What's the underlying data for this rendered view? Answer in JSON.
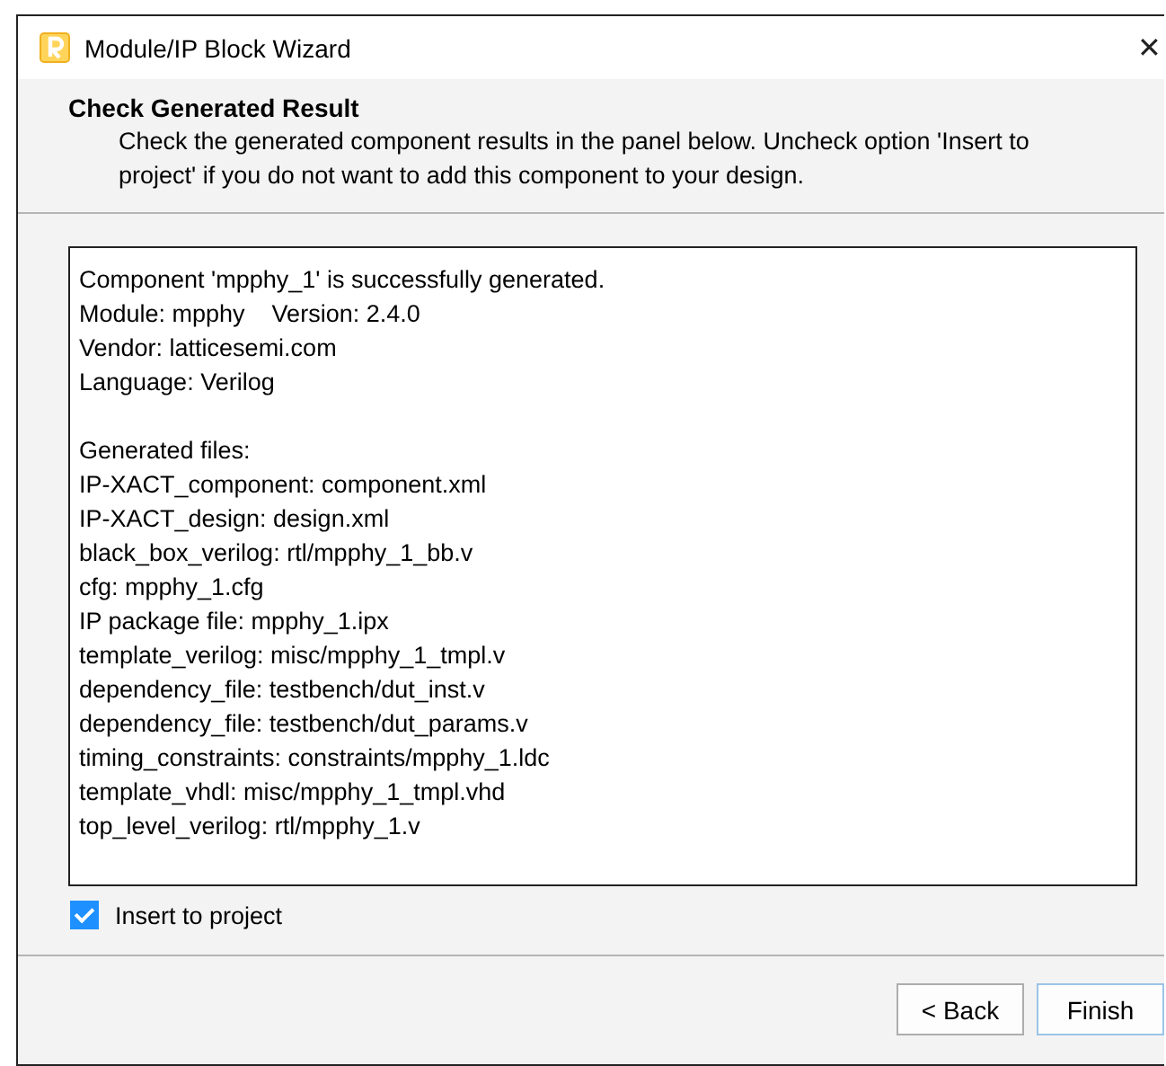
{
  "window": {
    "title": "Module/IP Block Wizard",
    "close": "✕"
  },
  "header": {
    "title": "Check Generated Result",
    "description": "Check the generated component results in the panel below. Uncheck option 'Insert to project' if you do not want to add this component to your design."
  },
  "output": {
    "sections": [
      {
        "lines": [
          "Component 'mpphy_1' is successfully generated.",
          "Module: mpphy    Version: 2.4.0",
          "Vendor: latticesemi.com",
          "Language: Verilog"
        ]
      },
      {
        "lines": [
          "Generated files:",
          "IP-XACT_component: component.xml",
          "IP-XACT_design: design.xml",
          "black_box_verilog: rtl/mpphy_1_bb.v",
          "cfg: mpphy_1.cfg",
          "IP package file: mpphy_1.ipx",
          "template_verilog: misc/mpphy_1_tmpl.v",
          "dependency_file: testbench/dut_inst.v",
          "dependency_file: testbench/dut_params.v",
          "timing_constraints: constraints/mpphy_1.ldc",
          "template_vhdl: misc/mpphy_1_tmpl.vhd",
          "top_level_verilog: rtl/mpphy_1.v"
        ]
      }
    ]
  },
  "insert_to_project": {
    "label": "Insert to project",
    "checked": true
  },
  "buttons": [
    {
      "label": "< Back",
      "default": false
    },
    {
      "label": "Finish",
      "default": true
    }
  ]
}
